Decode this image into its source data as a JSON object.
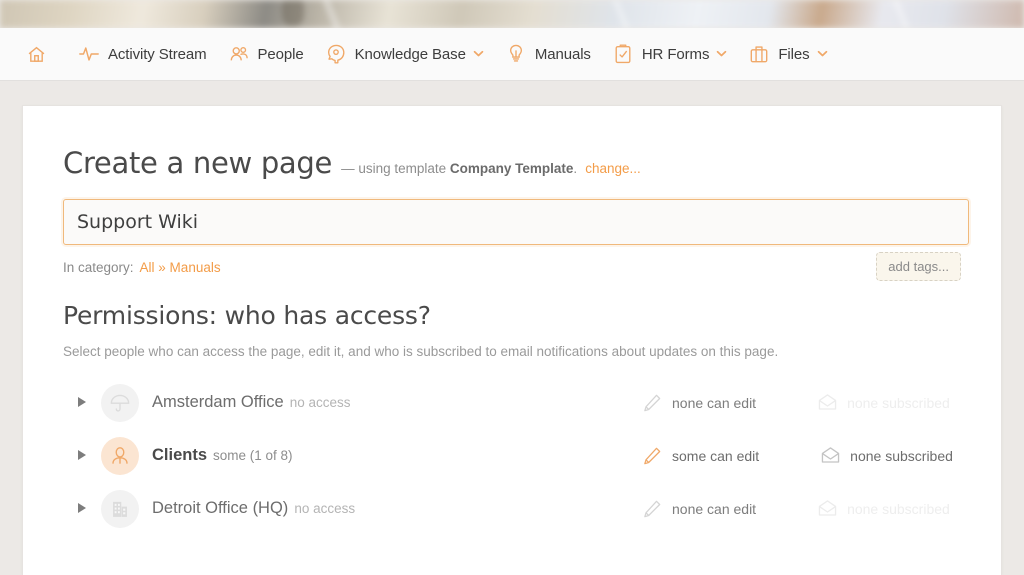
{
  "nav": {
    "items": [
      {
        "icon": "home-icon",
        "label": "",
        "caret": false
      },
      {
        "icon": "activity-icon",
        "label": "Activity Stream",
        "caret": false
      },
      {
        "icon": "people-icon",
        "label": "People",
        "caret": false
      },
      {
        "icon": "knowledge-base-icon",
        "label": "Knowledge Base",
        "caret": true
      },
      {
        "icon": "lightbulb-icon",
        "label": "Manuals",
        "caret": false
      },
      {
        "icon": "clipboard-icon",
        "label": "HR Forms",
        "caret": true
      },
      {
        "icon": "briefcase-icon",
        "label": "Files",
        "caret": true
      }
    ]
  },
  "page": {
    "title": "Create a new page",
    "subtitle_prefix": "— using template",
    "template_name": "Company Template",
    "subtitle_suffix": ".",
    "change_link": "change..."
  },
  "title_input": {
    "value": "Support Wiki",
    "placeholder": "Page title"
  },
  "category": {
    "label": "In category:",
    "path": "All » Manuals",
    "add_tags_label": "add tags..."
  },
  "permissions": {
    "heading": "Permissions: who has access?",
    "description": "Select people who can access the page, edit it, and who is subscribed to email notifications about updates on this page.",
    "edit_icon": "pencil-icon",
    "subscribe_icon": "envelope-icon",
    "expand_icon": "triangle-right-icon",
    "rows": [
      {
        "avatar_icon": "umbrella-icon",
        "name": "Amsterdam Office",
        "access_state": "no access",
        "edit_label": "none can edit",
        "subscribe_label": "none subscribed",
        "active": false,
        "dim_subscribe": true
      },
      {
        "avatar_icon": "person-icon",
        "name": "Clients",
        "access_state": "some (1 of 8)",
        "edit_label": "some can edit",
        "subscribe_label": "none subscribed",
        "active": true,
        "dim_subscribe": false
      },
      {
        "avatar_icon": "building-icon",
        "name": "Detroit Office (HQ)",
        "access_state": "no access",
        "edit_label": "none can edit",
        "subscribe_label": "none subscribed",
        "active": false,
        "dim_subscribe": true
      }
    ]
  },
  "colors": {
    "accent": "#f39c48",
    "icon_orange": "#f0a868",
    "page_bg": "#ece9e6",
    "card_bg": "#ffffff",
    "nav_bg": "#fafafa",
    "text_dark": "#4a4a4a",
    "text_muted": "#9a9a9a"
  }
}
